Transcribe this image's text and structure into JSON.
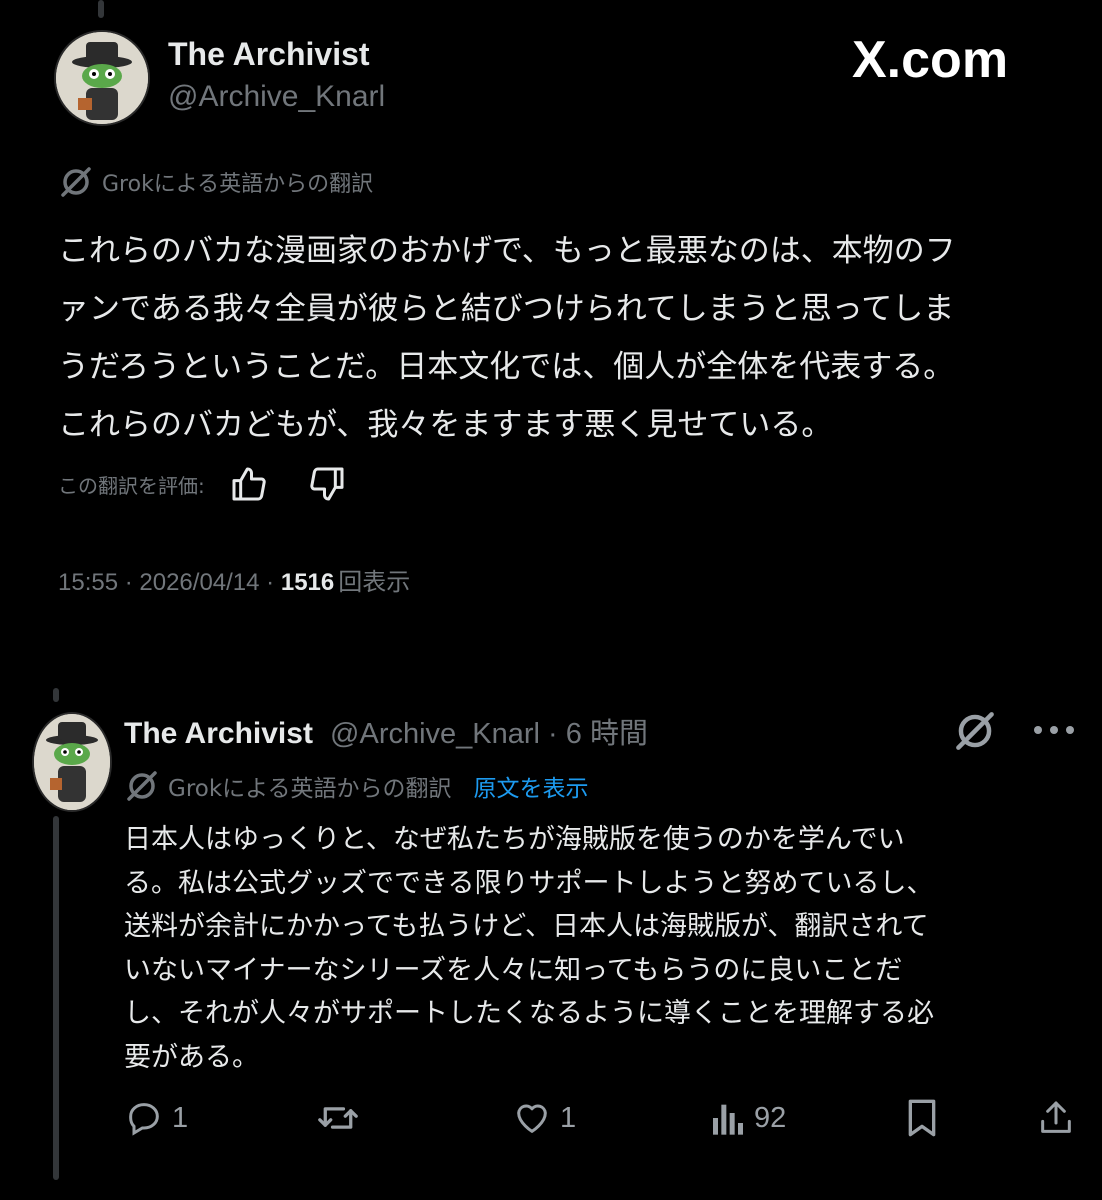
{
  "watermark": "X.com",
  "tweet1": {
    "display_name": "The Archivist",
    "handle": "@Archive_Knarl",
    "translation_note": "Grokによる英語からの翻訳",
    "lines": [
      "これらのバカな漫画家のおかげで、もっと最悪なのは、本物のフ",
      "ァンである我々全員が彼らと結びつけられてしまうと思ってしま",
      "うだろうということだ。日本文化では、個人が全体を代表する。",
      "これらのバカどもが、我々をますます悪く見せている。"
    ],
    "rate_label": "この翻訳を評価:",
    "time_date": "15:55 · 2026/04/14 · ",
    "views_count": "1516",
    "views_label": "回表示"
  },
  "tweet2": {
    "display_name": "The Archivist",
    "handle_time": "@Archive_Knarl · 6 時間",
    "translation_note": "Grokによる英語からの翻訳",
    "show_original": "原文を表示",
    "lines": [
      "日本人はゆっくりと、なぜ私たちが海賊版を使うのかを学んでい",
      "る。私は公式グッズでできる限りサポートしようと努めているし、",
      "送料が余計にかかっても払うけど、日本人は海賊版が、翻訳されて",
      "いないマイナーなシリーズを人々に知ってもらうのに良いことだ",
      "し、それが人々がサポートしたくなるように導くことを理解する必",
      "要がある。"
    ],
    "actions": {
      "reply_count": "1",
      "like_count": "1",
      "view_count": "92"
    }
  },
  "colors": {
    "background": "#000000",
    "text": "#e7e9ea",
    "muted": "#71767b",
    "link": "#1d9bf0"
  }
}
